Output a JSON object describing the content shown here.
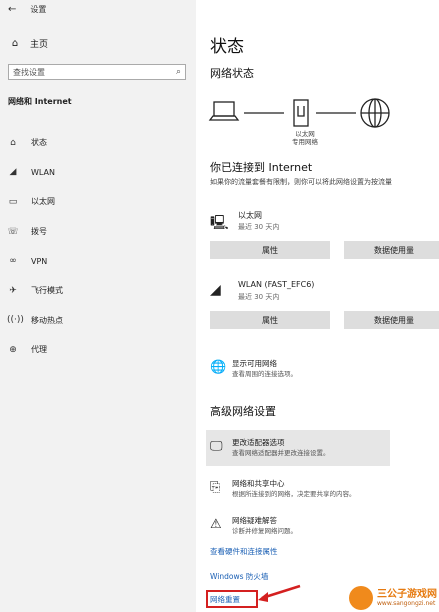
{
  "window": {
    "title": "设置",
    "back_icon": "arrow-left-icon"
  },
  "sidebar": {
    "home_label": "主页",
    "search_placeholder": "查找设置",
    "section_title": "网络和 Internet",
    "items": [
      {
        "label": "状态",
        "icon": "house-icon"
      },
      {
        "label": "WLAN",
        "icon": "wifi-icon"
      },
      {
        "label": "以太网",
        "icon": "ethernet-icon"
      },
      {
        "label": "拨号",
        "icon": "phone-icon"
      },
      {
        "label": "VPN",
        "icon": "vpn-icon"
      },
      {
        "label": "飞行模式",
        "icon": "airplane-icon"
      },
      {
        "label": "移动热点",
        "icon": "hotspot-icon"
      },
      {
        "label": "代理",
        "icon": "globe-icon"
      }
    ]
  },
  "main": {
    "title": "状态",
    "network_status_heading": "网络状态",
    "diagram_caption_line1": "以太网",
    "diagram_caption_line2": "专用网络",
    "connected_heading": "你已连接到 Internet",
    "connected_desc": "如果你的流量套餐有限制，则你可以将此网络设置为按流量",
    "connections": [
      {
        "name": "以太网",
        "sub": "最近 30 天内",
        "btn_props": "属性",
        "btn_usage": "数据使用量"
      },
      {
        "name": "WLAN (FAST_EFC6)",
        "sub": "最近 30 天内",
        "btn_props": "属性",
        "btn_usage": "数据使用量"
      }
    ],
    "show_networks": {
      "title": "显示可用网络",
      "sub": "查看周围的连接选项。"
    },
    "advanced_heading": "高级网络设置",
    "advanced": [
      {
        "title": "更改适配器选项",
        "sub": "查看网络适配器并更改连接设置。"
      },
      {
        "title": "网络和共享中心",
        "sub": "根据所连接到的网络，决定要共享的内容。"
      },
      {
        "title": "网络疑难解答",
        "sub": "诊断并修复网络问题。"
      }
    ],
    "links": {
      "hardware": "查看硬件和连接属性",
      "firewall": "Windows 防火墙",
      "reset": "网络重置"
    }
  },
  "watermark": {
    "name": "三公子游戏网",
    "url": "www.sangongzi.net"
  }
}
